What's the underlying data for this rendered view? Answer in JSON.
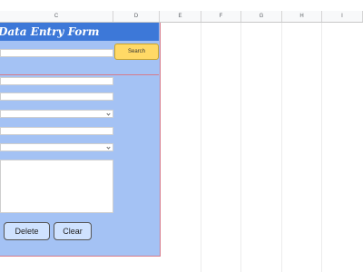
{
  "columns": [
    "C",
    "D",
    "E",
    "F",
    "G",
    "H",
    "I"
  ],
  "form": {
    "title": "Data Entry Form",
    "search_button": "Search",
    "delete_button": "Delete",
    "clear_button": "Clear"
  },
  "colors": {
    "form_background": "#a4c2f4",
    "title_background": "#3d78d8",
    "search_button": "#ffd966",
    "action_button": "#cfe2ff",
    "border_accent": "#d77a8a"
  },
  "icons": [
    "chevron-down-icon"
  ]
}
